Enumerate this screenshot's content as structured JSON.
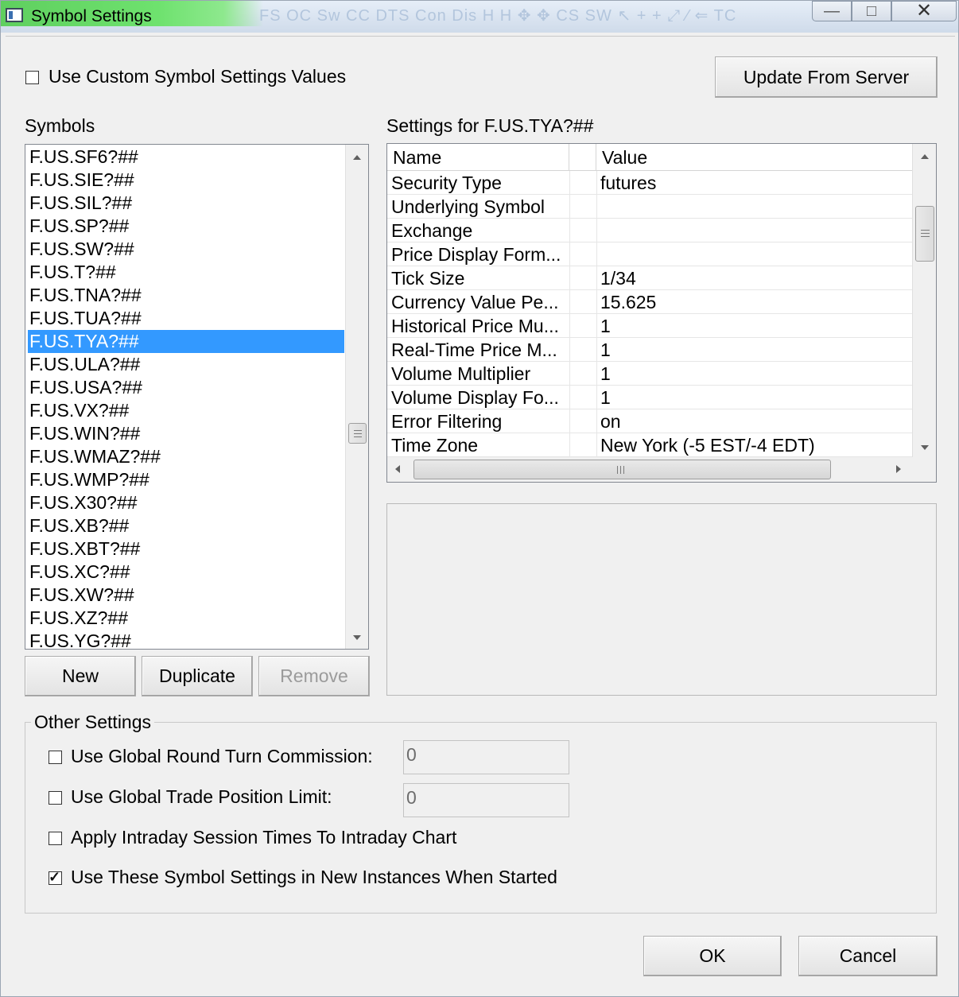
{
  "window": {
    "title": "Symbol Settings",
    "background_toolbar_text": "FS OC Sw CC DTS Con Dis  H  H  ✥  ✥ CS SW  ↖  +  +  ⤢  ⁄  ⇐  TC",
    "caption_buttons": {
      "minimize": "—",
      "maximize": "□",
      "close": "✕"
    }
  },
  "custom_settings": {
    "label": "Use Custom Symbol Settings Values",
    "checked": false
  },
  "update_button": "Update From Server",
  "symbols": {
    "heading": "Symbols",
    "items": [
      "F.US.SF6?##",
      "F.US.SIE?##",
      "F.US.SIL?##",
      "F.US.SP?##",
      "F.US.SW?##",
      "F.US.T?##",
      "F.US.TNA?##",
      "F.US.TUA?##",
      "F.US.TYA?##",
      "F.US.ULA?##",
      "F.US.USA?##",
      "F.US.VX?##",
      "F.US.WIN?##",
      "F.US.WMAZ?##",
      "F.US.WMP?##",
      "F.US.X30?##",
      "F.US.XB?##",
      "F.US.XBT?##",
      "F.US.XC?##",
      "F.US.XW?##",
      "F.US.XZ?##",
      "F.US.YG?##"
    ],
    "selected": "F.US.TYA?##"
  },
  "symbol_buttons": {
    "new": "New",
    "duplicate": "Duplicate",
    "remove": "Remove"
  },
  "settings": {
    "heading": "Settings for F.US.TYA?##",
    "columns": {
      "name": "Name",
      "value": "Value"
    },
    "rows": [
      {
        "name": "Security Type",
        "value": "futures"
      },
      {
        "name": "Underlying Symbol",
        "value": ""
      },
      {
        "name": "Exchange",
        "value": ""
      },
      {
        "name": "Price Display Form...",
        "value": ""
      },
      {
        "name": "Tick Size",
        "value": "1/34"
      },
      {
        "name": "Currency Value Pe...",
        "value": "15.625"
      },
      {
        "name": "Historical Price Mu...",
        "value": "1"
      },
      {
        "name": "Real-Time Price M...",
        "value": "1"
      },
      {
        "name": "Volume Multiplier",
        "value": "1"
      },
      {
        "name": "Volume Display Fo...",
        "value": "1"
      },
      {
        "name": "Error Filtering",
        "value": "on"
      },
      {
        "name": "Time Zone",
        "value": "New York (-5 EST/-4 EDT)"
      }
    ]
  },
  "other_settings": {
    "title": "Other Settings",
    "commission": {
      "label": "Use Global Round Turn Commission:",
      "value": "0",
      "checked": false
    },
    "position_limit": {
      "label": "Use Global Trade Position Limit:",
      "value": "0",
      "checked": false
    },
    "intraday": {
      "label": "Apply Intraday Session Times To Intraday Chart",
      "checked": false
    },
    "new_instances": {
      "label": "Use These Symbol Settings in New Instances When Started",
      "checked": true
    }
  },
  "dialog_buttons": {
    "ok": "OK",
    "cancel": "Cancel"
  }
}
